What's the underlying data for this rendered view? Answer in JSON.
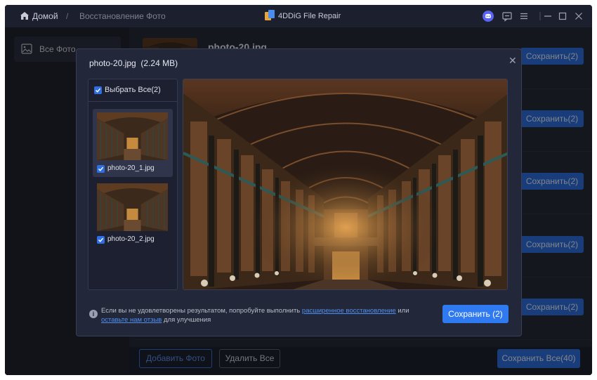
{
  "titlebar": {
    "home_label": "Домой",
    "separator": "/",
    "current_page": "Восстановление Фото",
    "app_name": "4DDiG File Repair"
  },
  "sidebar": {
    "items": [
      {
        "label": "Все Фото",
        "icon": "image-icon"
      }
    ]
  },
  "list": {
    "rows": [
      {
        "name": "photo-20.jpg",
        "save_label": "Сохранить(2)"
      },
      {
        "name": "",
        "save_label": "Сохранить(2)"
      },
      {
        "name": "",
        "save_label": "Сохранить(2)"
      },
      {
        "name": "",
        "save_label": "Сохранить(2)"
      },
      {
        "name": "",
        "save_label": "Сохранить(2)"
      }
    ]
  },
  "footer": {
    "add_label": "Добавить Фото",
    "delete_label": "Удалить Все",
    "save_all_label": "Сохранить Все(40)"
  },
  "modal": {
    "title": "photo-20.jpg",
    "size": "(2.24 MB)",
    "select_all_label": "Выбрать Все(2)",
    "items": [
      {
        "name": "photo-20_1.jpg",
        "checked": true,
        "selected": true
      },
      {
        "name": "photo-20_2.jpg",
        "checked": true,
        "selected": false
      }
    ],
    "info_prefix": "Если вы не удовлетворены результатом, попробуйте выполнить",
    "info_link1": "расширенное восстановление",
    "info_mid": "или",
    "info_link2": "оставьте нам отзыв",
    "info_suffix": "для улучшения",
    "save_label": "Сохранить (2)"
  },
  "colors": {
    "accent": "#2f6fe0",
    "link": "#4f8ff0",
    "discord": "#5865f2"
  }
}
